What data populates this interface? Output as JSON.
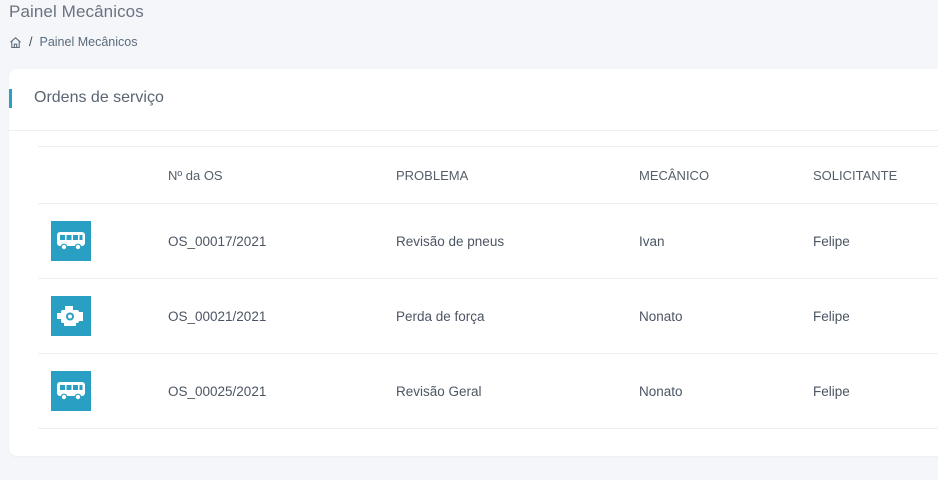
{
  "page": {
    "title": "Painel Mecânicos"
  },
  "breadcrumb": {
    "separator": "/",
    "current": "Painel Mecânicos"
  },
  "card": {
    "title": "Ordens de serviço",
    "accent_color": "#2a9fc4"
  },
  "table": {
    "columns": [
      "",
      "Nº da OS",
      "PROBLEMA",
      "MECÂNICO",
      "SOLICITANTE"
    ],
    "rows": [
      {
        "icon": "bus-icon",
        "os": "OS_00017/2021",
        "problema": "Revisão de pneus",
        "mecanico": "Ivan",
        "solicitante": "Felipe"
      },
      {
        "icon": "engine-icon",
        "os": "OS_00021/2021",
        "problema": "Perda de força",
        "mecanico": "Nonato",
        "solicitante": "Felipe"
      },
      {
        "icon": "bus-icon",
        "os": "OS_00025/2021",
        "problema": "Revisão Geral",
        "mecanico": "Nonato",
        "solicitante": "Felipe"
      }
    ]
  }
}
